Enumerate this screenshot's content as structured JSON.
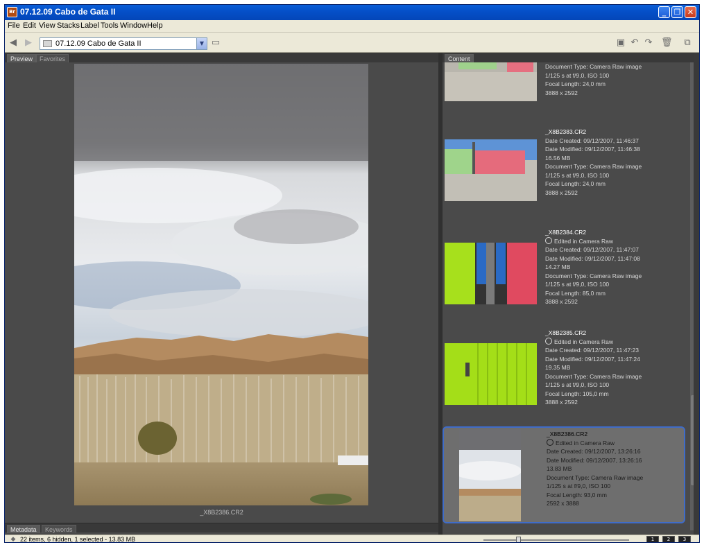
{
  "window": {
    "title": "07.12.09 Cabo de Gata II",
    "app_icon": "Br",
    "buttons": [
      "minimize",
      "restore",
      "close"
    ]
  },
  "menu": [
    "File",
    "Edit",
    "View",
    "Stacks",
    "Label",
    "Tools",
    "Window",
    "Help"
  ],
  "toolbar": {
    "path": "07.12.09 Cabo de Gata II",
    "icons": [
      "back-arrow-icon",
      "forward-arrow-icon",
      "folder-up-icon",
      "new-folder-icon",
      "rotate-left-icon",
      "rotate-right-icon",
      "trash-icon",
      "compact-mode-icon"
    ]
  },
  "left_panel": {
    "tabs": [
      "Preview",
      "Favorites"
    ],
    "active_tab": "Preview",
    "preview_caption": "_X8B2386.CR2",
    "bottom_tabs": [
      "Metadata",
      "Keywords"
    ]
  },
  "right_panel": {
    "tabs": [
      "Content"
    ],
    "items": [
      {
        "lines": [
          "Document Type: Camera Raw image",
          "1/125 s at f/9,0, ISO 100",
          "Focal Length: 24,0 mm",
          "3888 x 2592"
        ],
        "selected": false
      },
      {
        "filename": "_X8B2383.CR2",
        "lines": [
          "Date Created: 09/12/2007, 11:46:37",
          "Date Modified: 09/12/2007, 11:46:38",
          "16.56 MB",
          "Document Type: Camera Raw image",
          "1/125 s at f/9,0, ISO 100",
          "Focal Length: 24,0 mm",
          "3888 x 2592"
        ],
        "selected": false
      },
      {
        "filename": "_X8B2384.CR2",
        "edited": "Edited in Camera Raw",
        "lines": [
          "Date Created: 09/12/2007, 11:47:07",
          "Date Modified: 09/12/2007, 11:47:08",
          "14.27 MB",
          "Document Type: Camera Raw image",
          "1/125 s at f/9,0, ISO 100",
          "Focal Length: 85,0 mm",
          "3888 x 2592"
        ],
        "selected": false
      },
      {
        "filename": "_X8B2385.CR2",
        "edited": "Edited in Camera Raw",
        "lines": [
          "Date Created: 09/12/2007, 11:47:23",
          "Date Modified: 09/12/2007, 11:47:24",
          "19.35 MB",
          "Document Type: Camera Raw image",
          "1/125 s at f/9,0, ISO 100",
          "Focal Length: 105,0 mm",
          "3888 x 2592"
        ],
        "selected": false
      },
      {
        "filename": "_X8B2386.CR2",
        "edited": "Edited in Camera Raw",
        "lines": [
          "Date Created: 09/12/2007, 13:26:16",
          "Date Modified: 09/12/2007, 13:26:16",
          "13.83 MB",
          "Document Type: Camera Raw image",
          "1/125 s at f/9,0, ISO 100",
          "Focal Length: 93,0 mm",
          "2592 x 3888"
        ],
        "selected": true
      }
    ]
  },
  "statusbar": {
    "text": "22 items, 6 hidden, 1 selected - 13.83 MB",
    "view_buttons": [
      "1",
      "2",
      "3"
    ],
    "zoom_fraction": 0.25
  }
}
